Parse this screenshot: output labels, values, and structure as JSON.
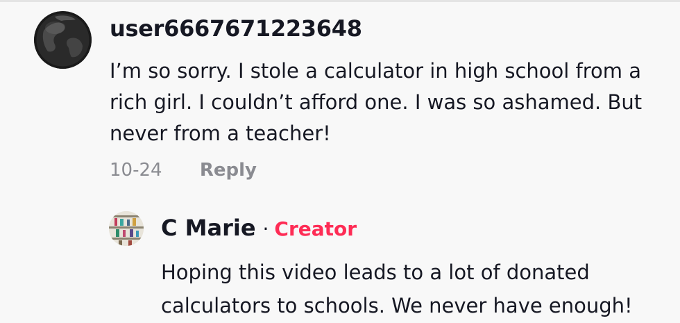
{
  "comment": {
    "username": "user6667671223648",
    "text": "I’m so sorry. I stole a calculator in high school from a rich girl. I couldn’t afford one. I was so ashamed. But never from a teacher!",
    "date": "10-24",
    "reply_label": "Reply",
    "avatar_icon": "globe-avatar-icon"
  },
  "reply": {
    "username": "C Marie",
    "separator": "·",
    "badge": "Creator",
    "badge_color": "#fe2c55",
    "text": "Hoping this video leads to a lot of donated calculators to schools. We never have enough!",
    "avatar_icon": "user-avatar-icon"
  }
}
